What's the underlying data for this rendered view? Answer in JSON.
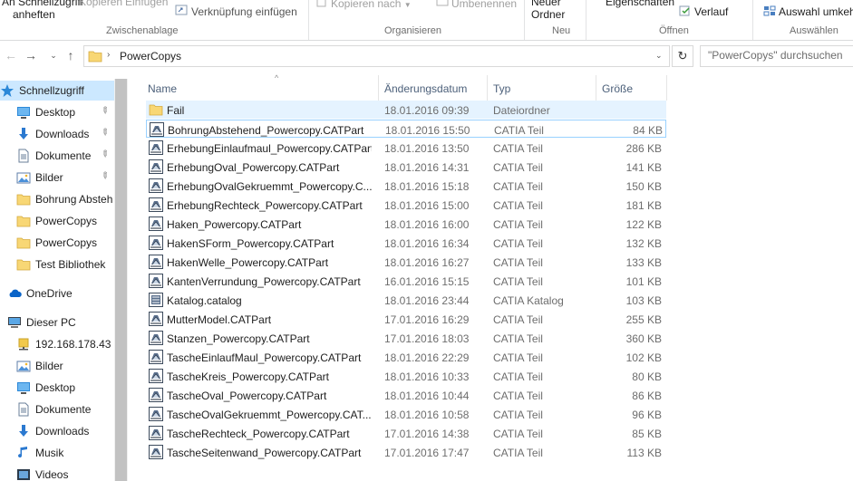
{
  "ribbon": {
    "pin_label_line1": "An Schnellzugriff",
    "pin_label_line2": "anheften",
    "copy_label": "Kopieren",
    "paste_label": "Einfügen",
    "paste_shortcut_label": "Verknüpfung einfügen",
    "group_clipboard": "Zwischenablage",
    "copy_to_label": "Kopieren nach",
    "rename_label": "Umbenennen",
    "group_organize": "Organisieren",
    "new_folder_line1": "Neuer",
    "new_folder_line2": "Ordner",
    "group_new": "Neu",
    "properties_label": "Eigenschaften",
    "history_label": "Verlauf",
    "group_open": "Öffnen",
    "invert_selection_label": "Auswahl umkehren",
    "group_select": "Auswählen"
  },
  "address": {
    "path": "PowerCopys",
    "search_placeholder": "\"PowerCopys\" durchsuchen"
  },
  "sidebar": {
    "items": [
      {
        "label": "Schnellzugriff",
        "icon": "star-icon"
      },
      {
        "label": "Desktop",
        "icon": "desktop-icon"
      },
      {
        "label": "Downloads",
        "icon": "download-icon"
      },
      {
        "label": "Dokumente",
        "icon": "documents-icon"
      },
      {
        "label": "Bilder",
        "icon": "pictures-icon"
      },
      {
        "label": "Bohrung Absteh",
        "icon": "folder-icon"
      },
      {
        "label": "PowerCopys",
        "icon": "folder-icon"
      },
      {
        "label": "PowerCopys",
        "icon": "folder-icon"
      },
      {
        "label": "Test Bibliothek",
        "icon": "folder-icon"
      },
      {
        "label": "OneDrive",
        "icon": "cloud-icon"
      },
      {
        "label": "Dieser PC",
        "icon": "computer-icon"
      },
      {
        "label": "192.168.178.43",
        "icon": "network-drive-icon"
      },
      {
        "label": "Bilder",
        "icon": "pictures-icon"
      },
      {
        "label": "Desktop",
        "icon": "desktop-icon"
      },
      {
        "label": "Dokumente",
        "icon": "documents-icon"
      },
      {
        "label": "Downloads",
        "icon": "download-icon"
      },
      {
        "label": "Musik",
        "icon": "music-icon"
      },
      {
        "label": "Videos",
        "icon": "video-icon"
      }
    ]
  },
  "columns": {
    "name": "Name",
    "date": "Änderungsdatum",
    "type": "Typ",
    "size": "Größe"
  },
  "files": [
    {
      "name": "Fail",
      "date": "18.01.2016 09:39",
      "type": "Dateiordner",
      "size": "",
      "icon": "folder-icon"
    },
    {
      "name": "BohrungAbstehend_Powercopy.CATPart",
      "date": "18.01.2016 15:50",
      "type": "CATIA Teil",
      "size": "84 KB",
      "icon": "catpart-icon"
    },
    {
      "name": "ErhebungEinlaufmaul_Powercopy.CATPart",
      "date": "18.01.2016 13:50",
      "type": "CATIA Teil",
      "size": "286 KB",
      "icon": "catpart-icon"
    },
    {
      "name": "ErhebungOval_Powercopy.CATPart",
      "date": "18.01.2016 14:31",
      "type": "CATIA Teil",
      "size": "141 KB",
      "icon": "catpart-icon"
    },
    {
      "name": "ErhebungOvalGekruemmt_Powercopy.C...",
      "date": "18.01.2016 15:18",
      "type": "CATIA Teil",
      "size": "150 KB",
      "icon": "catpart-icon"
    },
    {
      "name": "ErhebungRechteck_Powercopy.CATPart",
      "date": "18.01.2016 15:00",
      "type": "CATIA Teil",
      "size": "181 KB",
      "icon": "catpart-icon"
    },
    {
      "name": "Haken_Powercopy.CATPart",
      "date": "18.01.2016 16:00",
      "type": "CATIA Teil",
      "size": "122 KB",
      "icon": "catpart-icon"
    },
    {
      "name": "HakenSForm_Powercopy.CATPart",
      "date": "18.01.2016 16:34",
      "type": "CATIA Teil",
      "size": "132 KB",
      "icon": "catpart-icon"
    },
    {
      "name": "HakenWelle_Powercopy.CATPart",
      "date": "18.01.2016 16:27",
      "type": "CATIA Teil",
      "size": "133 KB",
      "icon": "catpart-icon"
    },
    {
      "name": "KantenVerrundung_Powercopy.CATPart",
      "date": "16.01.2016 15:15",
      "type": "CATIA Teil",
      "size": "101 KB",
      "icon": "catpart-icon"
    },
    {
      "name": "Katalog.catalog",
      "date": "18.01.2016 23:44",
      "type": "CATIA Katalog",
      "size": "103 KB",
      "icon": "catalog-icon"
    },
    {
      "name": "MutterModel.CATPart",
      "date": "17.01.2016 16:29",
      "type": "CATIA Teil",
      "size": "255 KB",
      "icon": "catpart-icon"
    },
    {
      "name": "Stanzen_Powercopy.CATPart",
      "date": "17.01.2016 18:03",
      "type": "CATIA Teil",
      "size": "360 KB",
      "icon": "catpart-icon"
    },
    {
      "name": "TascheEinlaufMaul_Powercopy.CATPart",
      "date": "18.01.2016 22:29",
      "type": "CATIA Teil",
      "size": "102 KB",
      "icon": "catpart-icon"
    },
    {
      "name": "TascheKreis_Powercopy.CATPart",
      "date": "18.01.2016 10:33",
      "type": "CATIA Teil",
      "size": "80 KB",
      "icon": "catpart-icon"
    },
    {
      "name": "TascheOval_Powercopy.CATPart",
      "date": "18.01.2016 10:44",
      "type": "CATIA Teil",
      "size": "86 KB",
      "icon": "catpart-icon"
    },
    {
      "name": "TascheOvalGekruemmt_Powercopy.CAT...",
      "date": "18.01.2016 10:58",
      "type": "CATIA Teil",
      "size": "96 KB",
      "icon": "catpart-icon"
    },
    {
      "name": "TascheRechteck_Powercopy.CATPart",
      "date": "17.01.2016 14:38",
      "type": "CATIA Teil",
      "size": "85 KB",
      "icon": "catpart-icon"
    },
    {
      "name": "TascheSeitenwand_Powercopy.CATPart",
      "date": "17.01.2016 17:47",
      "type": "CATIA Teil",
      "size": "113 KB",
      "icon": "catpart-icon"
    }
  ],
  "colors": {
    "selection": "#cce8ff",
    "hover": "#e5f3ff",
    "folder": "#f8d775",
    "accent": "#0078d7"
  }
}
